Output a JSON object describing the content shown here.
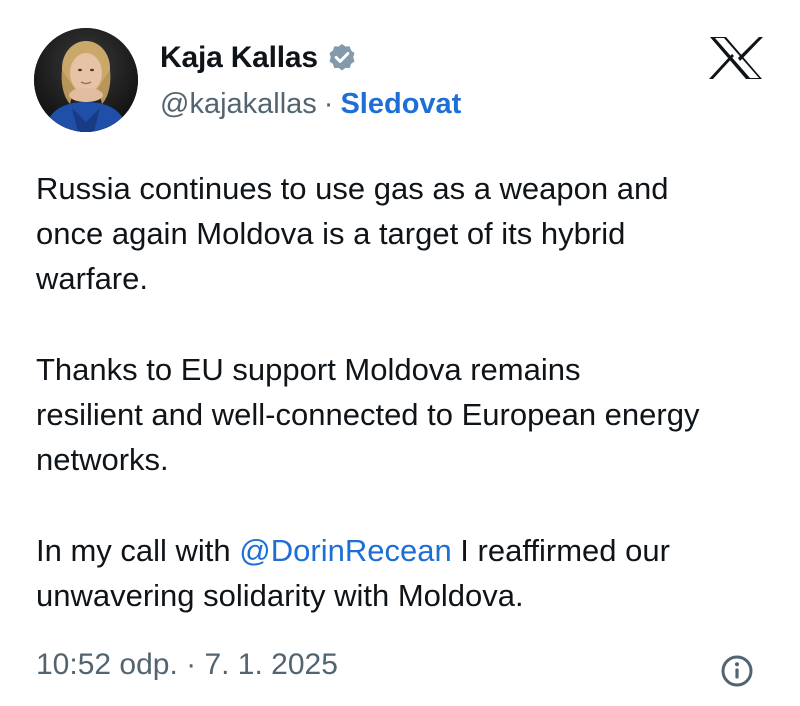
{
  "author": {
    "display_name": "Kaja Kallas",
    "handle": "@kajakallas",
    "separator": "·",
    "follow_label": "Sledovat",
    "verified_icon": "verified-badge-icon"
  },
  "brand": {
    "logo": "x-logo-icon"
  },
  "tweet": {
    "paragraph1_lines": [
      "Russia continues to use gas as a weapon and",
      "once again Moldova is a target of its hybrid",
      "warfare."
    ],
    "paragraph2_lines": [
      "Thanks to EU support Moldova remains",
      "resilient and well-connected to European energy",
      "networks."
    ],
    "paragraph3": {
      "prefix": "In my call with ",
      "mention": "@DorinRecean",
      "suffix_line1": " I reaffirmed our",
      "line2": "unwavering solidarity with Moldova."
    }
  },
  "meta": {
    "timestamp": "10:52 odp. · 7. 1. 2025",
    "info_icon": "info-icon"
  },
  "colors": {
    "link": "#1d6fd6",
    "text": "#0f1419",
    "muted": "#536471",
    "verified_badge": "#829aab"
  }
}
